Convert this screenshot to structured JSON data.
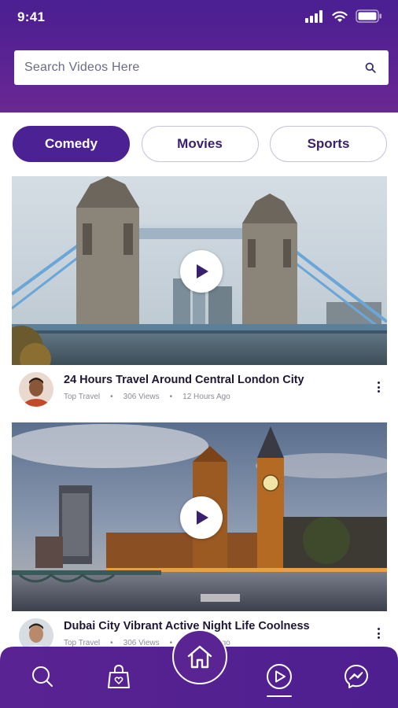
{
  "status_bar": {
    "time": "9:41"
  },
  "search": {
    "placeholder": "Search Videos Here"
  },
  "tabs": [
    {
      "label": "Comedy",
      "active": true
    },
    {
      "label": "Movies",
      "active": false
    },
    {
      "label": "Sports",
      "active": false
    }
  ],
  "videos": [
    {
      "title": "24 Hours Travel Around Central London City",
      "channel": "Top Travel",
      "views": "306 Views",
      "age": "12 Hours Ago"
    },
    {
      "title": "Dubai City Vibrant Active Night Life Coolness",
      "channel": "Top Travel",
      "views": "306 Views",
      "age": "12 Hours Ago"
    }
  ],
  "bottom_nav": {
    "items": [
      "search-icon",
      "shopping-bag-icon",
      "home-icon",
      "play-circle-icon",
      "messenger-icon"
    ],
    "active": "play-circle-icon"
  },
  "colors": {
    "primary": "#4b2193",
    "header_gradient_end": "#6a2892",
    "tab_border": "#c9c2d8",
    "text_dark": "#1f1633",
    "text_muted": "#8d8a98"
  }
}
